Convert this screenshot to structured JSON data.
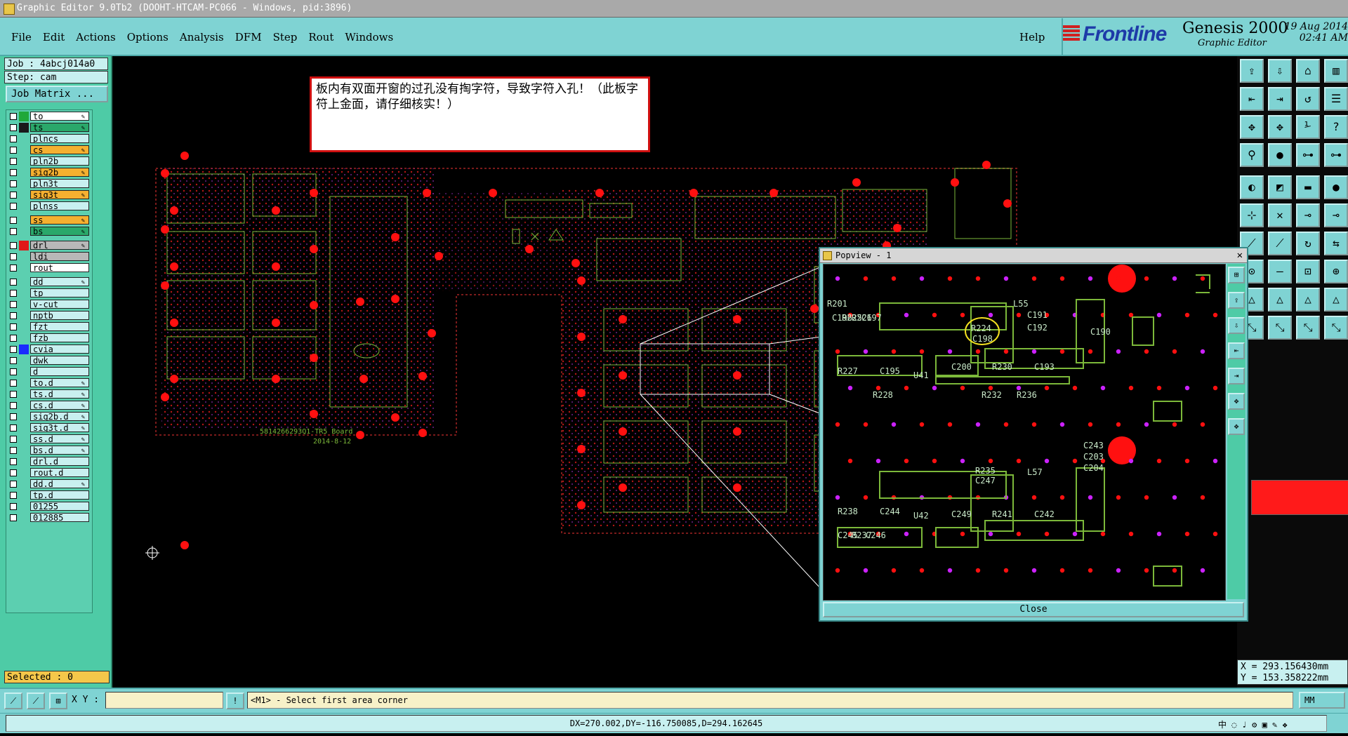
{
  "window": {
    "title": "Graphic Editor 9.0Tb2 (DOOHT-HTCAM-PC066 - Windows, pid:3896)"
  },
  "menu": {
    "items": [
      "File",
      "Edit",
      "Actions",
      "Options",
      "Analysis",
      "DFM",
      "Step",
      "Rout",
      "Windows"
    ],
    "help": "Help"
  },
  "brand": {
    "logo": "Frontline",
    "product": "Genesis 2000",
    "subtitle": "Graphic Editor",
    "date": "19 Aug 2014",
    "time": "02:41 AM"
  },
  "job": {
    "job_label": "Job : 4abcj014a0",
    "step_label": "Step: cam",
    "matrix_button": "Job Matrix ..."
  },
  "layers": [
    {
      "name": "to",
      "swatch": "#1fa83a",
      "bg": "#ffffff",
      "edit": true
    },
    {
      "name": "ts",
      "swatch": "#1a1a1a",
      "bg": "#2aa86a",
      "edit": true
    },
    {
      "name": "plncs",
      "swatch": "",
      "bg": "#c8f0f0",
      "edit": false
    },
    {
      "name": "cs",
      "swatch": "",
      "bg": "#f5b030",
      "edit": true
    },
    {
      "name": "pln2b",
      "swatch": "",
      "bg": "#c8f0f0",
      "edit": false
    },
    {
      "name": "sig2b",
      "swatch": "",
      "bg": "#f5b030",
      "edit": true
    },
    {
      "name": "pln3t",
      "swatch": "",
      "bg": "#c8f0f0",
      "edit": false
    },
    {
      "name": "sig3t",
      "swatch": "",
      "bg": "#f5b030",
      "edit": true
    },
    {
      "name": "plnss",
      "swatch": "",
      "bg": "#c8f0f0",
      "edit": false
    },
    {
      "name": "ss",
      "swatch": "",
      "bg": "#f5b030",
      "edit": true
    },
    {
      "name": "bs",
      "swatch": "",
      "bg": "#2aa86a",
      "edit": true
    },
    {
      "name": "drl",
      "swatch": "#e01818",
      "bg": "#b8b8b8",
      "edit": true
    },
    {
      "name": "ldi",
      "swatch": "",
      "bg": "#b8b8b8",
      "edit": false
    },
    {
      "name": "rout",
      "swatch": "",
      "bg": "#ffffff",
      "edit": false
    },
    {
      "name": "dd",
      "swatch": "",
      "bg": "#c8f0f0",
      "edit": true
    },
    {
      "name": "tp",
      "swatch": "",
      "bg": "#c8f0f0",
      "edit": false
    },
    {
      "name": "v-cut",
      "swatch": "",
      "bg": "#c8f0f0",
      "edit": false
    },
    {
      "name": "nptb",
      "swatch": "",
      "bg": "#c8f0f0",
      "edit": false
    },
    {
      "name": "fzt",
      "swatch": "",
      "bg": "#c8f0f0",
      "edit": false
    },
    {
      "name": "fzb",
      "swatch": "",
      "bg": "#c8f0f0",
      "edit": false
    },
    {
      "name": "cvia",
      "swatch": "#1a2aff",
      "bg": "#c8f0f0",
      "edit": false
    },
    {
      "name": "dwk",
      "swatch": "",
      "bg": "#c8f0f0",
      "edit": false
    },
    {
      "name": "d",
      "swatch": "",
      "bg": "#c8f0f0",
      "edit": false
    },
    {
      "name": "to.d",
      "swatch": "",
      "bg": "#c8f0f0",
      "edit": true
    },
    {
      "name": "ts.d",
      "swatch": "",
      "bg": "#c8f0f0",
      "edit": true
    },
    {
      "name": "cs.d",
      "swatch": "",
      "bg": "#c8f0f0",
      "edit": true
    },
    {
      "name": "sig2b.d",
      "swatch": "",
      "bg": "#c8f0f0",
      "edit": true
    },
    {
      "name": "sig3t.d",
      "swatch": "",
      "bg": "#c8f0f0",
      "edit": true
    },
    {
      "name": "ss.d",
      "swatch": "",
      "bg": "#c8f0f0",
      "edit": true
    },
    {
      "name": "bs.d",
      "swatch": "",
      "bg": "#c8f0f0",
      "edit": true
    },
    {
      "name": "drl.d",
      "swatch": "",
      "bg": "#c8f0f0",
      "edit": false
    },
    {
      "name": "rout.d",
      "swatch": "",
      "bg": "#c8f0f0",
      "edit": false
    },
    {
      "name": "dd.d",
      "swatch": "",
      "bg": "#c8f0f0",
      "edit": true
    },
    {
      "name": "tp.d",
      "swatch": "",
      "bg": "#c8f0f0",
      "edit": false
    },
    {
      "name": "01255",
      "swatch": "",
      "bg": "#c8f0f0",
      "edit": false
    },
    {
      "name": "012885",
      "swatch": "",
      "bg": "#c8f0f0",
      "edit": false
    }
  ],
  "selected": "Selected : 0",
  "annotation": {
    "text": "板内有双面开窗的过孔没有掏字符，导致字符入孔！（此板字符上金面，请仔细核实！）"
  },
  "board": {
    "label1": "5814266293Q1-TR5 Board",
    "label2": "2014-8-12"
  },
  "popview": {
    "title": "Popview - 1",
    "close": "Close",
    "labels": [
      "C196",
      "R225",
      "R226",
      "C197",
      "R201",
      "L55",
      "C191",
      "C192",
      "C190",
      "R224",
      "C198",
      "R227",
      "C195",
      "C200",
      "R230",
      "C193",
      "U41",
      "C245",
      "R237",
      "R238",
      "C246",
      "L57",
      "C243",
      "C203",
      "C204",
      "R235",
      "C247",
      "C244",
      "C249",
      "R241",
      "C242",
      "U42",
      "R228",
      "R232",
      "R236"
    ]
  },
  "coords": {
    "x": "X = 293.156430mm",
    "y": "Y = 153.358222mm"
  },
  "cmd": {
    "xy_label": "X Y :",
    "xy_value": "",
    "prompt": "<M1> - Select first area corner",
    "units": "MM"
  },
  "status": {
    "text": "DX=270.002,DY=-116.750085,D=294.162645"
  },
  "tray": {
    "text": "中 ◌ ♩ ⚙ ▣ ✎ ❖"
  }
}
